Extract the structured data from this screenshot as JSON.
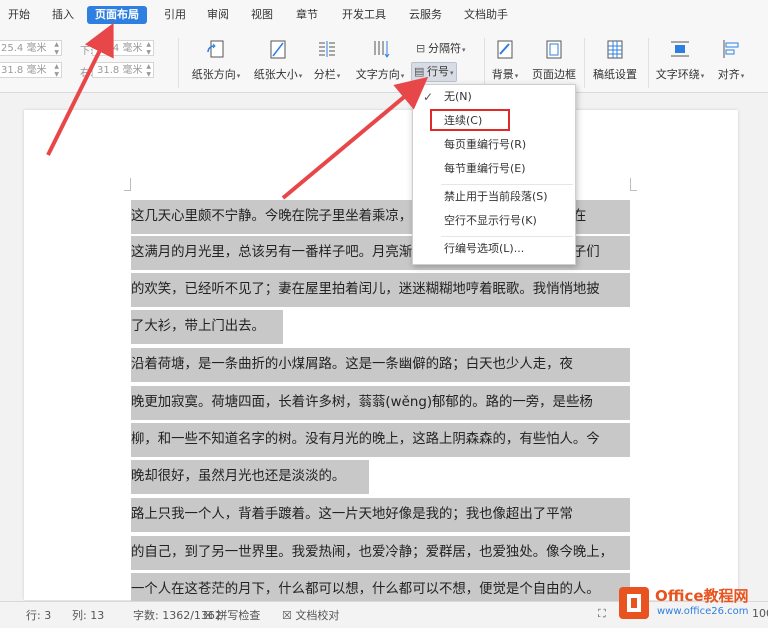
{
  "menubar": {
    "tabs": [
      "开始",
      "插入",
      "页面布局",
      "引用",
      "审阅",
      "视图",
      "章节",
      "开发工具",
      "云服务",
      "文档助手"
    ],
    "active_tab": "页面布局"
  },
  "ribbon": {
    "margins": [
      "25.4 毫米",
      "25.4 毫米",
      "31.8 毫米",
      "31.8 毫米"
    ],
    "margin_labels": [
      "下:",
      "右:"
    ],
    "buttons": {
      "orientation": "纸张方向",
      "size": "纸张大小",
      "columns": "分栏",
      "text_direction": "文字方向",
      "separator": "分隔符",
      "line_numbers": "行号",
      "background": "背景",
      "page_border": "页面边框",
      "paper_setup": "稿纸设置",
      "text_wrap": "文字环绕",
      "align": "对齐"
    }
  },
  "dropdown": {
    "items": [
      "无(N)",
      "连续(C)",
      "每页重编行号(R)",
      "每节重编行号(E)",
      "禁止用于当前段落(S)",
      "空行不显示行号(K)",
      "行编号选项(L)..."
    ],
    "checked": "无(N)",
    "highlighted": "连续(C)"
  },
  "document": {
    "lines": [
      " 这几天心里颇不宁静。今晚在院子里坐着乘凉，忽然想起日日走过的荷塘，在",
      "这满月的月光里，总该另有一番样子吧。月亮渐渐地升高了，墙外马路上孩子们",
      "的欢笑，已经听不见了；妻在屋里拍着闰儿，迷迷糊糊地哼着眠歌。我悄悄地披",
      "了大衫，带上门出去。",
      "    沿着荷塘，是一条曲折的小煤屑路。这是一条幽僻的路；白天也少人走，夜",
      "晚更加寂寞。荷塘四面，长着许多树，蓊蓊(wěng)郁郁的。路的一旁，是些杨",
      "柳，和一些不知道名字的树。没有月光的晚上，这路上阴森森的，有些怕人。今",
      "晚却很好，虽然月光也还是淡淡的。",
      "    路上只我一个人，背着手踱着。这一片天地好像是我的；我也像超出了平常",
      "的自己，到了另一世界里。我爱热闹，也爱冷静；爱群居，也爱独处。像今晚上，",
      "一个人在这苍茫的月下，什么都可以想，什么都可以不想，便觉是个自由的人。"
    ]
  },
  "statusbar": {
    "items": [
      "行: 3",
      "列: 13",
      "字数: 1362/1362",
      "拼写检查",
      "文档校对",
      "100"
    ]
  },
  "watermark": {
    "brand": "Office教程网",
    "url": "www.office26.com"
  },
  "colors": {
    "accent": "#2f7fe0",
    "arrow": "#e8474a",
    "highlight_box": "#e02a2a",
    "selection": "#c8c8c8"
  }
}
